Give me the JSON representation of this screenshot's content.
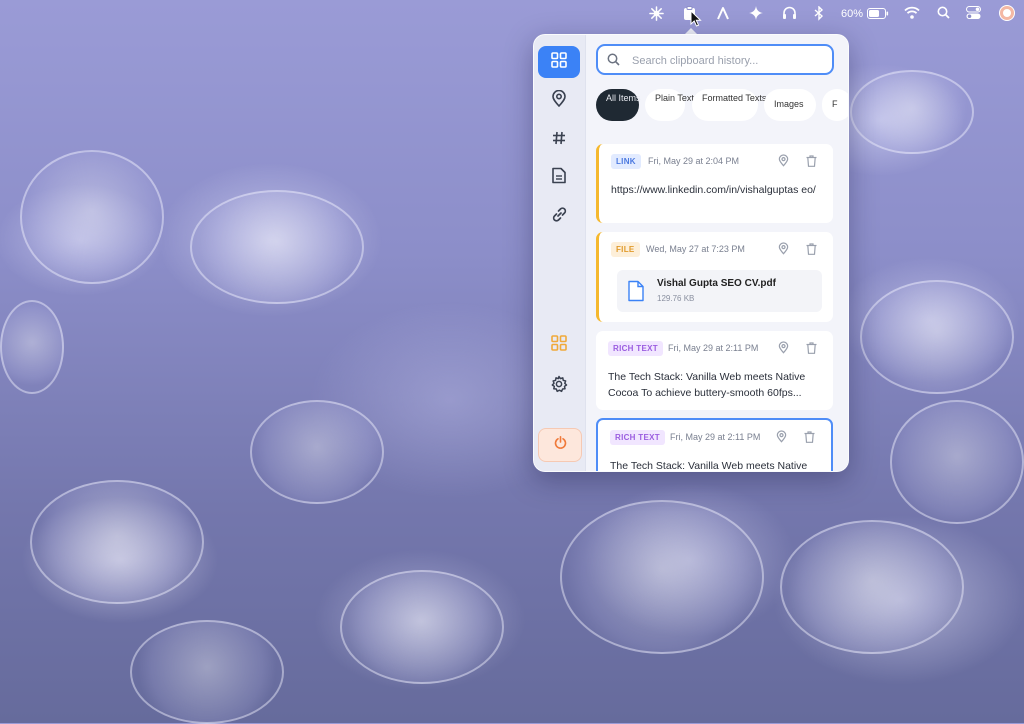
{
  "menubar": {
    "battery_percent": "60%",
    "icons": [
      "sparkle-burst-icon",
      "clipboard-app-icon",
      "arrow-up-icon",
      "star-icon",
      "headphones-icon",
      "bluetooth-icon",
      "battery-icon",
      "wifi-icon",
      "search-icon",
      "control-center-icon",
      "user-avatar-icon"
    ]
  },
  "sidebar": {
    "items": [
      "grid-icon",
      "pin-icon",
      "hash-icon",
      "document-icon",
      "link-icon"
    ],
    "bottom": [
      "apps-grid-icon",
      "gear-icon",
      "power-icon"
    ],
    "active_color": "#3b82f6"
  },
  "search": {
    "placeholder": "Search clipboard history..."
  },
  "chips": [
    {
      "label": "All Items",
      "active": true
    },
    {
      "label": "Plain Text"
    },
    {
      "label": "Formatted Texts"
    },
    {
      "label": "Images"
    },
    {
      "label": "F"
    }
  ],
  "cards": [
    {
      "type": "LINK",
      "date": "Fri, May 29 at 2:04 PM",
      "text": "https://www.linkedin.com/in/vishalguptas eo/"
    },
    {
      "type": "FILE",
      "date": "Wed, May 27 at 7:23 PM",
      "file_name": "Vishal Gupta SEO CV.pdf",
      "file_size": "129.76 KB"
    },
    {
      "type": "RICH TEXT",
      "date": "Fri, May 29 at 2:11 PM",
      "text": "The Tech Stack: Vanilla Web meets Native Cocoa To achieve buttery-smooth 60fps..."
    },
    {
      "type": "RICH TEXT",
      "date": "Fri, May 29 at 2:11 PM",
      "text": "The Tech Stack: Vanilla Web meets Native"
    }
  ]
}
